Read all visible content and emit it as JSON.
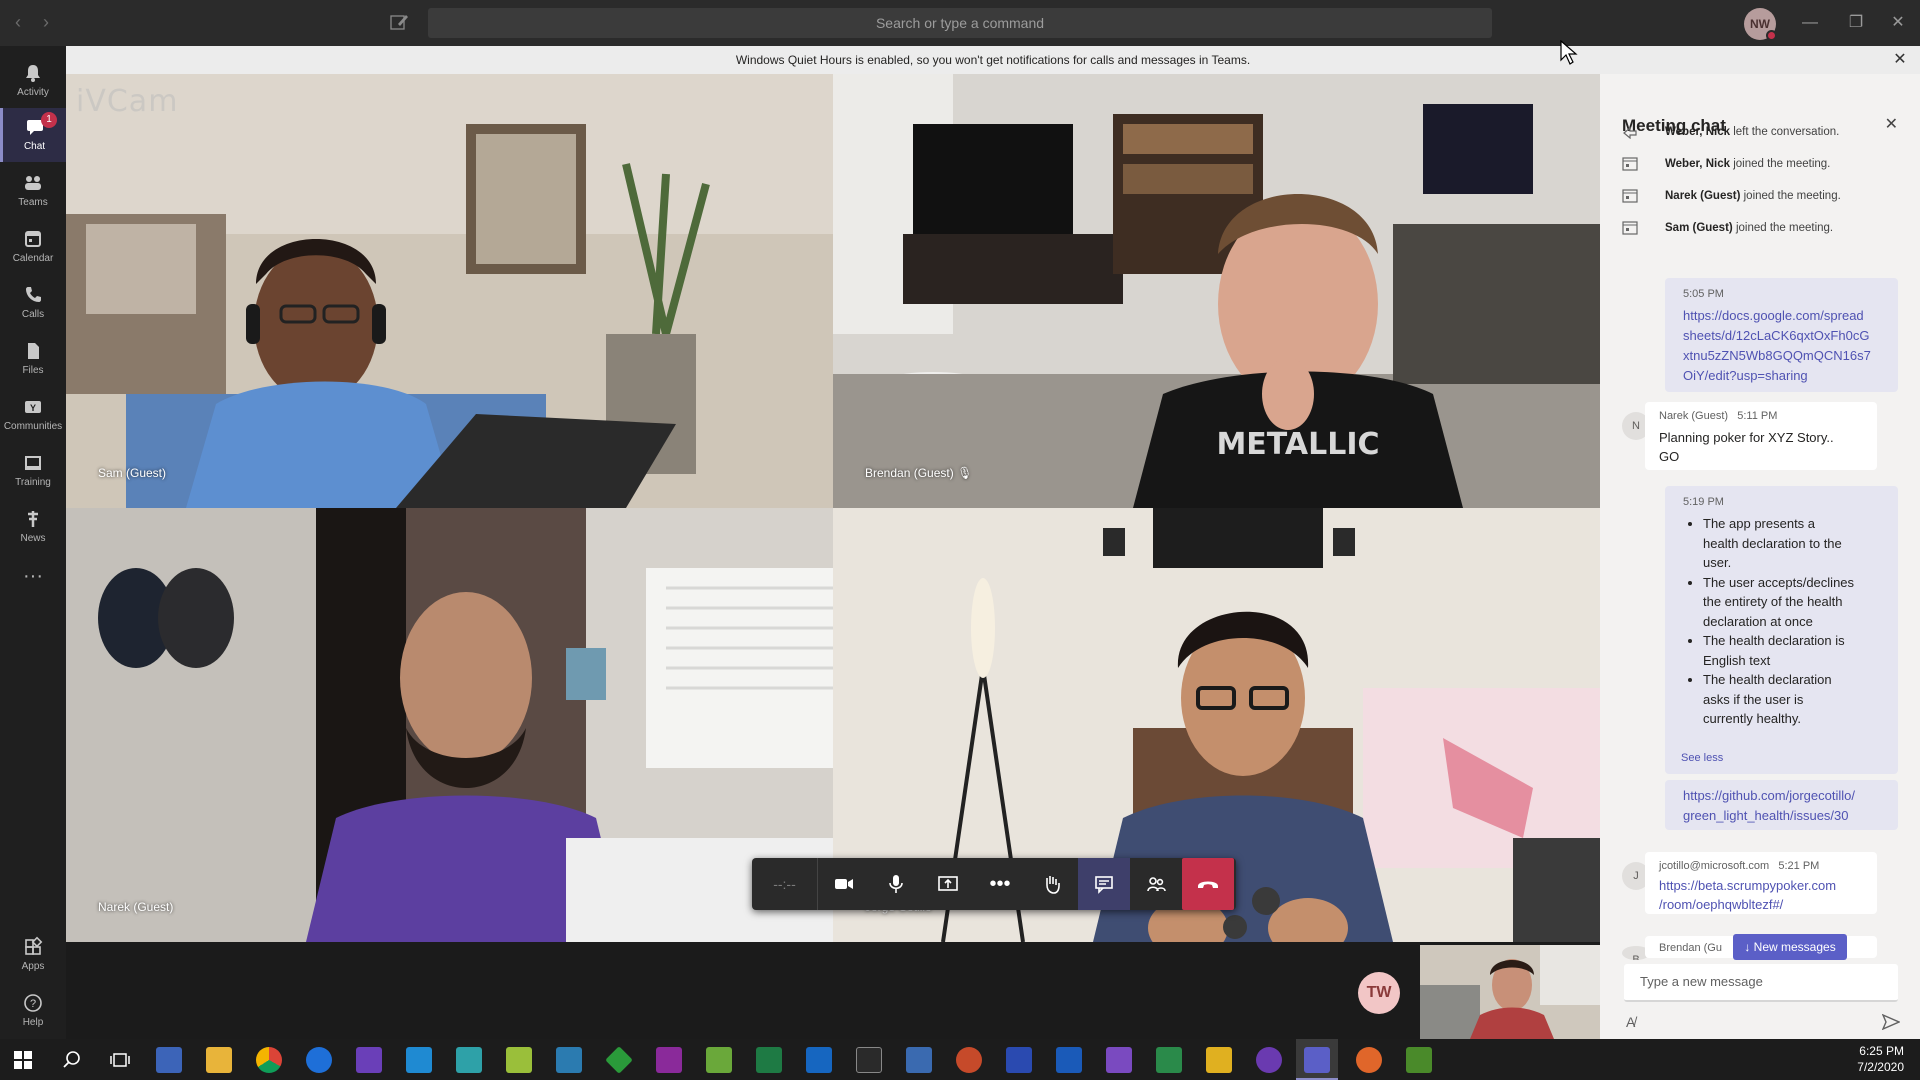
{
  "titlebar": {
    "search_placeholder": "Search or type a command",
    "user_initials": "NW"
  },
  "appbar": {
    "items": [
      {
        "label": "Activity",
        "icon": "bell-icon"
      },
      {
        "label": "Chat",
        "icon": "chat-icon",
        "badge": "1"
      },
      {
        "label": "Teams",
        "icon": "teams-icon"
      },
      {
        "label": "Calendar",
        "icon": "calendar-icon"
      },
      {
        "label": "Calls",
        "icon": "phone-icon"
      },
      {
        "label": "Files",
        "icon": "file-icon"
      },
      {
        "label": "Communities",
        "icon": "communities-icon"
      },
      {
        "label": "Training",
        "icon": "training-icon"
      },
      {
        "label": "News",
        "icon": "news-icon"
      }
    ],
    "apps_label": "Apps",
    "help_label": "Help"
  },
  "banner": {
    "text": "Windows Quiet Hours is enabled, so you won't get notifications for calls and messages in Teams."
  },
  "stage": {
    "watermark": "iVCam",
    "participants": [
      {
        "name": "Sam (Guest)"
      },
      {
        "name": "Brendan (Guest)"
      },
      {
        "name": "Narek (Guest)"
      },
      {
        "name": "Jorge Cotillo"
      }
    ],
    "timer": "--:--",
    "self_initials": "TW"
  },
  "chat": {
    "title": "Meeting chat",
    "events": [
      {
        "who": "Weber, Nick",
        "what": " left the conversation."
      },
      {
        "who": "Weber, Nick",
        "what": " joined the meeting."
      },
      {
        "who": "Narek (Guest)",
        "what": " joined the meeting."
      },
      {
        "who": "Sam (Guest)",
        "what": " joined the meeting."
      }
    ],
    "msg1": {
      "time": "5:05 PM",
      "link_lines": [
        "https://docs.google.com/spread",
        "sheets/d/12cLaCK6qxtOxFh0cG",
        "xtnu5zZN5Wb8GQQmQCN16s7",
        "OiY/edit?usp=sharing"
      ]
    },
    "msg2": {
      "avatar": "N",
      "author": "Narek (Guest)",
      "time": "5:11 PM",
      "lines": [
        "Planning poker for XYZ Story..",
        "GO"
      ]
    },
    "msg3": {
      "time": "5:19 PM",
      "bullets": [
        [
          "The app presents a",
          "health declaration to the",
          "user."
        ],
        [
          "The user accepts/declines",
          "the entirety of the health",
          "declaration at once"
        ],
        [
          "The health declaration is",
          "English text"
        ],
        [
          "The health declaration",
          "asks if the user is",
          "currently healthy."
        ]
      ],
      "see_less": "See less",
      "link_lines": [
        "https://github.com/jorgecotillo/",
        "green_light_health/issues/30"
      ]
    },
    "msg4": {
      "avatar": "J",
      "author": "jcotillo@microsoft.com",
      "time": "5:21 PM",
      "link_lines": [
        "https://beta.scrumpypoker.com",
        "/room/oephqwbltezf#/"
      ]
    },
    "msg5": {
      "avatar": "B",
      "author": "Brendan (Gu"
    },
    "new_messages": "New messages",
    "compose_placeholder": "Type a new message"
  },
  "taskbar": {
    "time": "6:25 PM",
    "date": "7/2/2020"
  },
  "colors": {
    "accent": "#6264a7",
    "hangup": "#c4314b",
    "badge": "#c4314b"
  }
}
